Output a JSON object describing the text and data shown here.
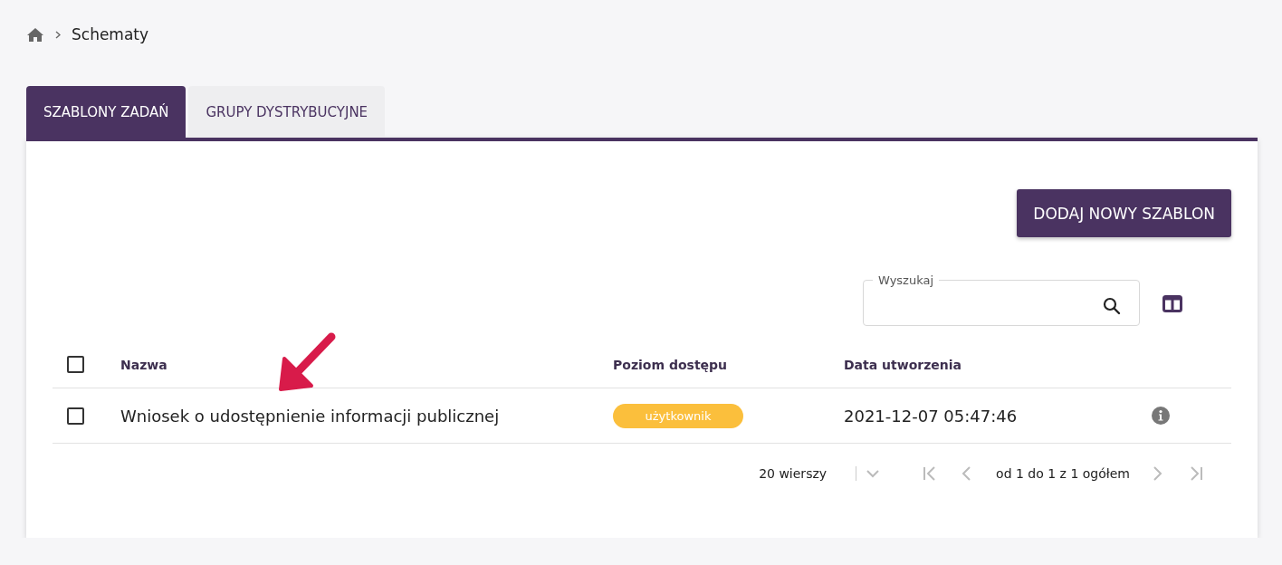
{
  "breadcrumb": {
    "items": [
      "Schematy"
    ]
  },
  "tabs": [
    {
      "label": "SZABLONY ZADAŃ",
      "selected": true
    },
    {
      "label": "GRUPY DYSTRYBUCYJNE",
      "selected": false
    }
  ],
  "add_button": "DODAJ NOWY SZABLON",
  "search": {
    "label": "Wyszukaj"
  },
  "table": {
    "select_all_checked": false,
    "columns": [
      "Nazwa",
      "Poziom dostępu",
      "Data utworzenia"
    ],
    "rows": [
      {
        "checked": false,
        "name": "Wniosek o udostępnienie informacji publicznej",
        "access": "użytkownik",
        "created": "2021-12-07 05:47:46"
      }
    ]
  },
  "pagination": {
    "rows_per_page": "20 wierszy",
    "range": "od 1 do 1 z 1 ogółem",
    "buttons": [
      {
        "kind": "first",
        "disabled": true
      },
      {
        "kind": "prev",
        "disabled": true
      },
      {
        "kind": "next",
        "disabled": true
      },
      {
        "kind": "last",
        "disabled": true
      }
    ]
  }
}
